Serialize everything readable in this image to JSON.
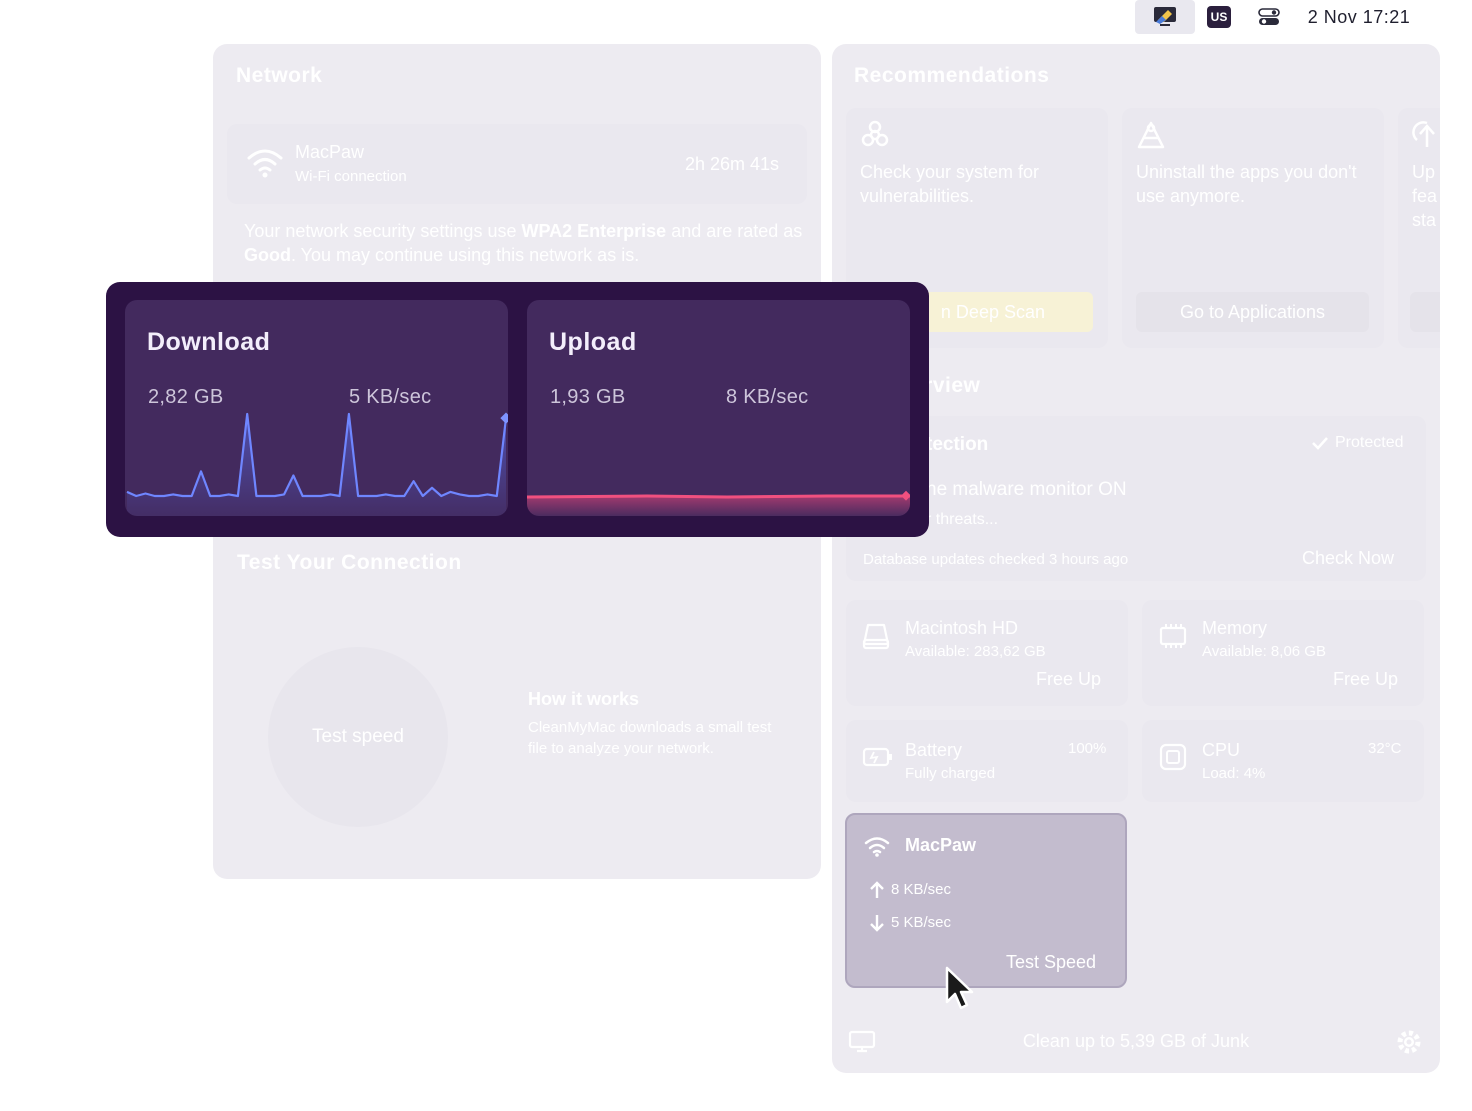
{
  "menubar": {
    "keyboard_badge": "US",
    "datetime": "2 Nov  17:21"
  },
  "network": {
    "title": "Network",
    "wifi_name": "MacPaw",
    "wifi_type": "Wi-Fi connection",
    "duration": "2h 26m 41s",
    "security_pre": "Your network security settings use ",
    "security_protocol": "WPA2 Enterprise",
    "security_mid": " and are rated as ",
    "security_rating": "Good",
    "security_post": ". You may continue using this network as is.",
    "test_title": "Test Your Connection",
    "test_button": "Test speed",
    "how_title": "How it works",
    "how_text": "CleanMyMac downloads a small test file to analyze your network."
  },
  "speed": {
    "download": {
      "label": "Download",
      "total": "2,82 GB",
      "rate": "5 KB/sec",
      "series": [
        0.05,
        0.0,
        0.03,
        0.0,
        0.0,
        0.02,
        0.0,
        0.0,
        0.3,
        0.0,
        0.0,
        0.02,
        0.0,
        1.0,
        0.0,
        0.0,
        0.0,
        0.02,
        0.25,
        0.0,
        0.0,
        0.0,
        0.02,
        0.0,
        1.0,
        0.0,
        0.0,
        0.0,
        0.02,
        0.0,
        0.0,
        0.18,
        0.0,
        0.1,
        0.0,
        0.05,
        0.02,
        0.0,
        0.0,
        0.02,
        0.0,
        0.95
      ]
    },
    "upload": {
      "label": "Upload",
      "total": "1,93 GB",
      "rate": "8 KB/sec"
    }
  },
  "recommendations": {
    "title": "Recommendations",
    "items": [
      {
        "text": "Check your system for vulnerabilities.",
        "button": "n Deep Scan",
        "icon": "biohazard-icon"
      },
      {
        "text": "Uninstall the apps you don't use anymore.",
        "button": "Go to Applications",
        "icon": "apps-icon"
      },
      {
        "text": "Up fea sta",
        "button": "",
        "icon": "update-icon"
      }
    ]
  },
  "overview": {
    "title": "erview",
    "protection_title": "tection",
    "protected_label": "Protected",
    "monitor_text": "he malware monitor ON",
    "monitor_sub": "r threats...",
    "db_text": "Database updates checked 3 hours ago",
    "check_now": "Check Now",
    "disk": {
      "name": "Macintosh HD",
      "available": "Available: 283,62 GB",
      "action": "Free Up"
    },
    "memory": {
      "name": "Memory",
      "available": "Available: 8,06 GB",
      "action": "Free Up"
    },
    "battery": {
      "name": "Battery",
      "status": "Fully charged",
      "percent": "100%"
    },
    "cpu": {
      "name": "CPU",
      "load": "Load: 4%",
      "temp": "32°C"
    }
  },
  "widget": {
    "name": "MacPaw",
    "upload_rate": "8 KB/sec",
    "download_rate": "5 KB/sec",
    "action": "Test Speed"
  },
  "footer": {
    "junk_text": "Clean up to 5,39 GB of Junk"
  }
}
